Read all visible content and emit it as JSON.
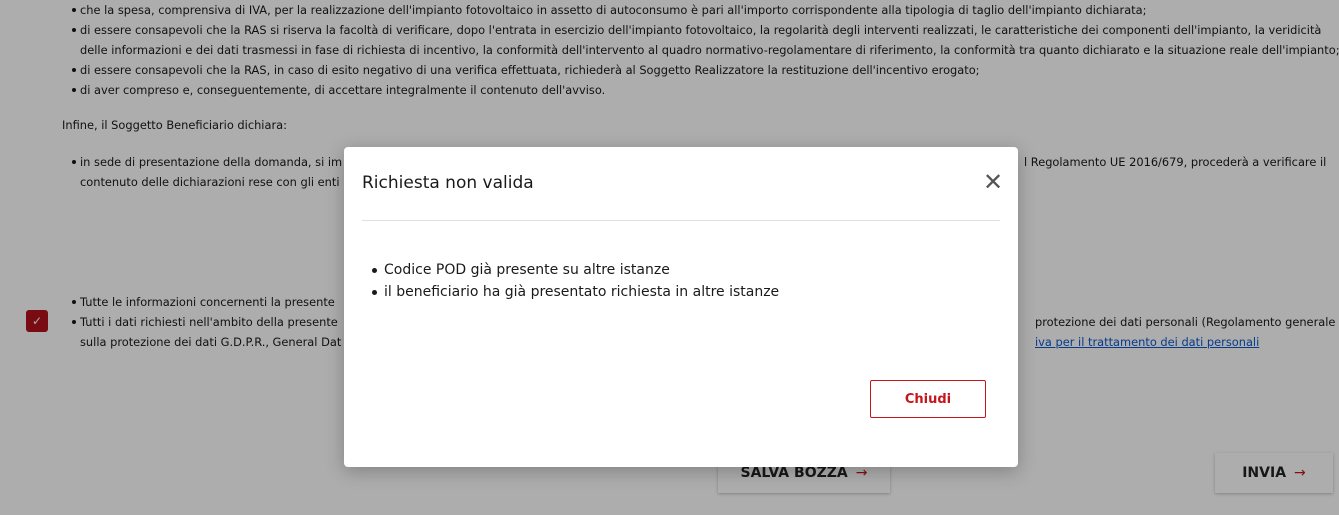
{
  "background": {
    "block1": [
      "che la spesa, comprensiva di IVA, per la realizzazione dell'impianto fotovoltaico in assetto di autoconsumo è pari all'importo corrispondente alla tipologia di taglio dell'impianto dichiarata;",
      "di essere consapevoli che la RAS si riserva la facoltà di verificare, dopo l'entrata in esercizio dell'impianto fotovoltaico, la regolarità degli interventi realizzati, le caratteristiche dei componenti dell'impianto, la veridicità delle informazioni e dei dati trasmessi in fase di richiesta di incentivo, la conformità dell'intervento al quadro normativo-regolamentare di riferimento, la conformità tra quanto dichiarato e la situazione reale dell'impianto;",
      "di essere consapevoli che la RAS, in caso di esito negativo di una verifica effettuata, richiederà al Soggetto Realizzatore la restituzione dell'incentivo erogato;",
      "di aver compreso e, conseguentemente, di accettare integralmente il contenuto dell'avviso."
    ],
    "infine": "Infine, il Soggetto Beneficiario dichiara:",
    "block2_left": "in sede di presentazione della domanda, si im",
    "block2_left_2": "contenuto delle dichiarazioni rese con gli enti",
    "block2_right": "l Regolamento UE 2016/679, procederà a verificare il",
    "block3_left_1": "Tutte le informazioni concernenti la presente",
    "block3_left_2": "Tutti i dati richiesti nell'ambito della presente",
    "block3_left_3": "sulla protezione dei dati G.D.P.R., General Dat",
    "block3_right_2": "protezione dei dati personali (Regolamento generale",
    "block3_link": "iva per il trattamento dei dati personali",
    "checkbox_mark": "✓"
  },
  "buttons": {
    "salva_label": "SALVA BOZZA",
    "invia_label": "INVIA",
    "arrow": "→"
  },
  "modal": {
    "title": "Richiesta non valida",
    "close_glyph": "✕",
    "errors": [
      "Codice POD già presente su altre istanze",
      "il beneficiario ha già presentato richiesta in altre istanze"
    ],
    "close_button_label": "Chiudi"
  }
}
